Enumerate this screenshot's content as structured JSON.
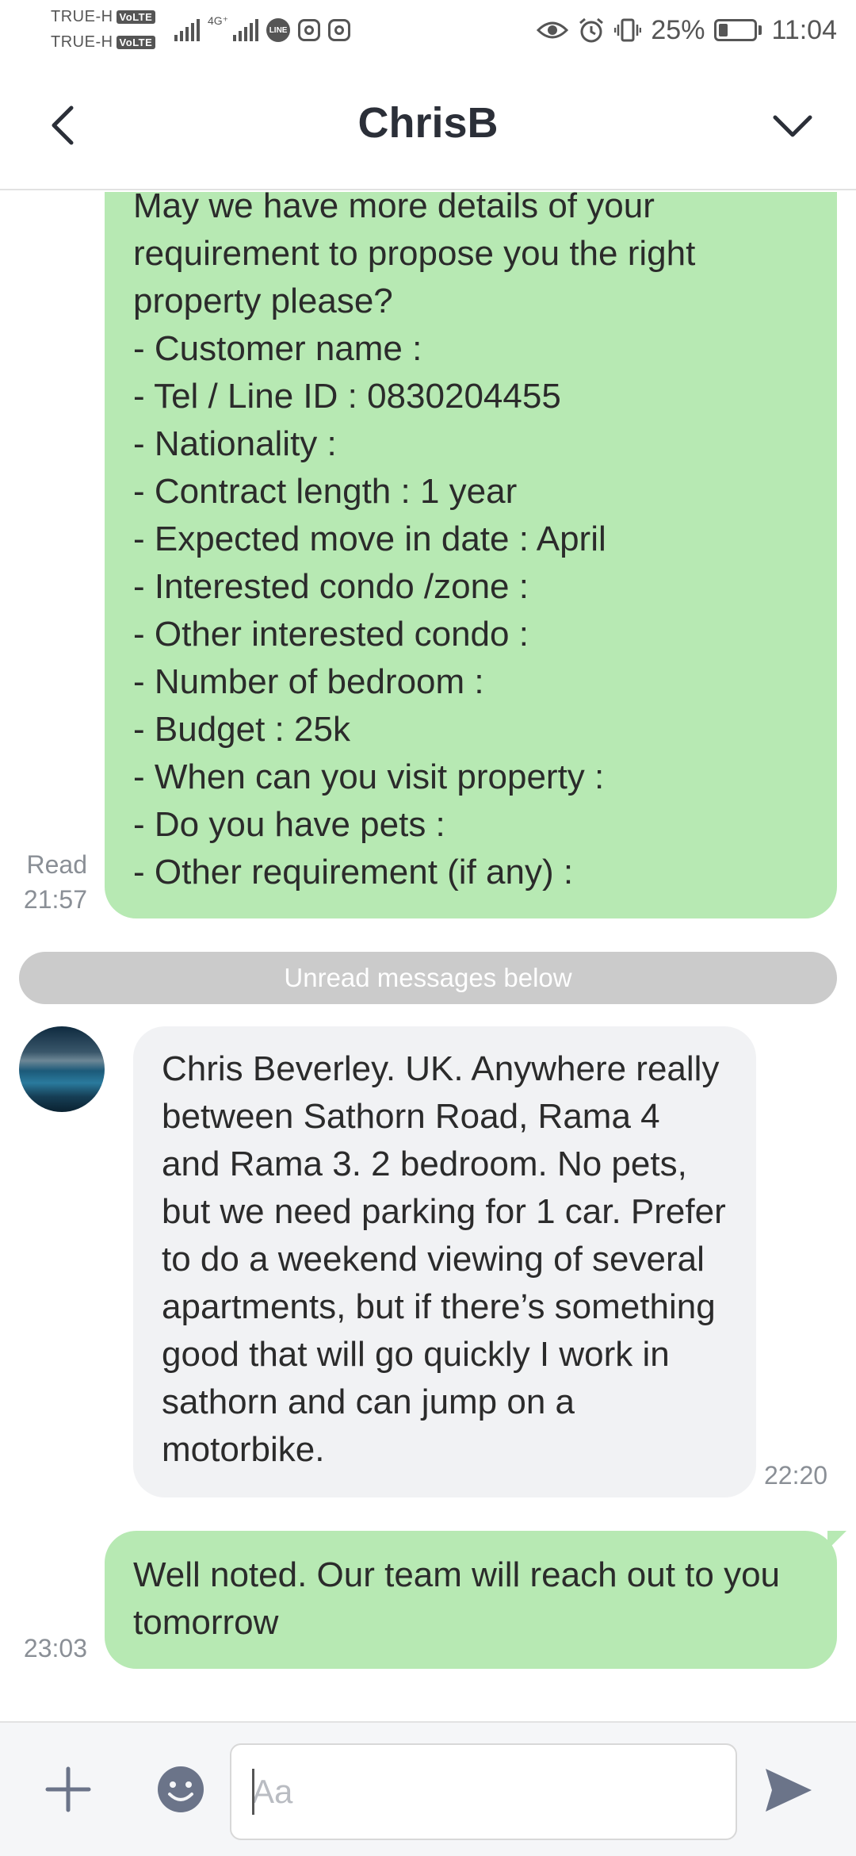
{
  "status_bar": {
    "carrier_1": "TRUE-H",
    "carrier_2": "TRUE-H",
    "volte_label": "VoLTE",
    "network_tag": "4G⁺",
    "line_app_label": "LINE",
    "battery_percent": "25%",
    "battery_level": 0.25,
    "time": "11:04",
    "icons": [
      "signal-icon",
      "line-app-icon",
      "instagram-icon",
      "instagram-icon",
      "eye-icon",
      "alarm-icon",
      "vibrate-icon",
      "battery-icon"
    ]
  },
  "header": {
    "title": "ChrisB",
    "back_icon": "chevron-left-icon",
    "menu_icon": "chevron-down-icon"
  },
  "messages": [
    {
      "direction": "outgoing",
      "text": "May we have more details of your requirement to propose you the right property please?\n- Customer name :\n- Tel / Line ID : 0830204455\n- Nationality :\n- Contract length : 1 year\n- Expected move in date : April\n- Interested condo /zone :\n- Other interested condo :\n- Number of bedroom  :\n- Budget : 25k\n- When can you visit property :\n- Do you have pets :\n- Other requirement (if any) :",
      "read_label": "Read",
      "time": "21:57"
    },
    {
      "direction": "incoming",
      "text": "Chris Beverley. UK. Anywhere really between Sathorn Road, Rama 4 and Rama 3. 2 bedroom. No pets, but we need parking for 1 car. Prefer to do a weekend viewing of several apartments, but if there’s something good that will go quickly I work in sathorn and can jump on a motorbike.",
      "time": "22:20"
    },
    {
      "direction": "outgoing",
      "text": "Well noted. Our team will reach out to you tomorrow",
      "time": "23:03"
    }
  ],
  "divider": {
    "unread_label": "Unread messages below"
  },
  "composer": {
    "placeholder": "Aa",
    "value": "",
    "plus_icon": "plus-icon",
    "emoji_icon": "emoji-icon",
    "send_icon": "send-icon"
  },
  "colors": {
    "outgoing_bubble": "#b7e9b3",
    "incoming_bubble": "#f1f2f4",
    "unread_divider": "#cbcbcb",
    "timestamp": "#8a8f96",
    "icon": "#6b7489"
  }
}
